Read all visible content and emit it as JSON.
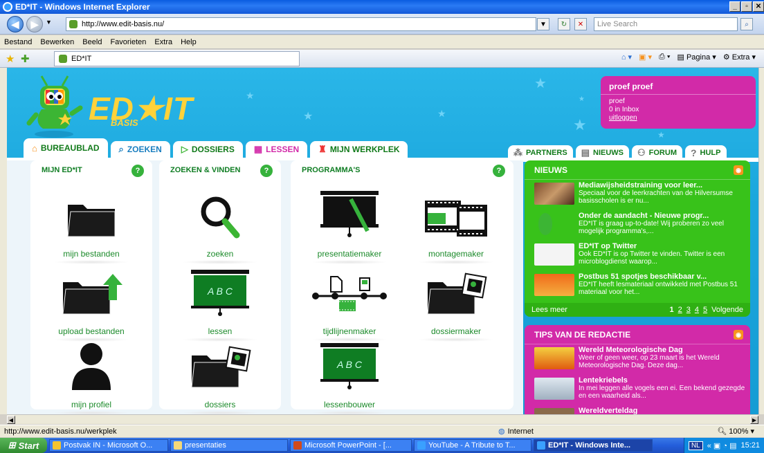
{
  "window": {
    "title": "ED*IT - Windows Internet Explorer"
  },
  "address": {
    "url": "http://www.edit-basis.nu/",
    "search_placeholder": "Live Search"
  },
  "menu": [
    "Bestand",
    "Bewerken",
    "Beeld",
    "Favorieten",
    "Extra",
    "Help"
  ],
  "tab": {
    "title": "ED*IT"
  },
  "commandbar": {
    "page": "Pagina",
    "extra": "Extra"
  },
  "site": {
    "logo_text": "ED★IT",
    "logo_sub": "BASIS",
    "user": {
      "name": "proef proef",
      "line1": "proef",
      "inbox": "0 in Inbox",
      "logout": "uitloggen"
    },
    "tabs_left": [
      {
        "label": "BUREAUBLAD",
        "icon": "home-icon"
      },
      {
        "label": "ZOEKEN",
        "icon": "search-icon"
      },
      {
        "label": "DOSSIERS",
        "icon": "dossier-icon"
      },
      {
        "label": "LESSEN",
        "icon": "lessons-icon"
      },
      {
        "label": "MIJN WERKPLEK",
        "icon": "workplace-icon"
      }
    ],
    "tabs_right": [
      {
        "label": "PARTNERS",
        "icon": "partners-icon"
      },
      {
        "label": "NIEUWS",
        "icon": "news-icon"
      },
      {
        "label": "FORUM",
        "icon": "forum-icon"
      },
      {
        "label": "HULP",
        "icon": "help-icon"
      }
    ],
    "sections": {
      "mijn": {
        "title": "MIJN ED*IT",
        "help": "?",
        "items": [
          "mijn bestanden",
          "upload bestanden",
          "mijn profiel"
        ]
      },
      "zoeken": {
        "title": "ZOEKEN & VINDEN",
        "help": "?",
        "items": [
          "zoeken",
          "lessen",
          "dossiers"
        ]
      },
      "programmas": {
        "title": "PROGRAMMA'S",
        "help": "?",
        "items": [
          "presentatiemaker",
          "montagemaker",
          "tijdlijnenmaker",
          "dossiermaker",
          "lessenbouwer"
        ]
      }
    },
    "board_text": "A B C",
    "nieuws": {
      "title": "NIEUWS",
      "items": [
        {
          "title": "Mediawijsheidstraining voor leer...",
          "text": "Speciaal voor de leerkrachten van de Hilversumse basisscholen is er nu..."
        },
        {
          "title": "Onder de aandacht - Nieuwe progr...",
          "text": "ED*IT is graag up-to-date! Wij proberen zo veel mogelijk programma's,..."
        },
        {
          "title": "ED*IT op Twitter",
          "text": "Ook ED*IT is op Twitter te vinden. Twitter is een microblogdienst waarop..."
        },
        {
          "title": "Postbus 51 spotjes beschikbaar v...",
          "text": "ED*IT heeft lesmateriaal ontwikkeld met Postbus 51 materiaal voor het..."
        }
      ],
      "more": "Lees meer",
      "pages": [
        "1",
        "2",
        "3",
        "4",
        "5"
      ],
      "next": "Volgende"
    },
    "tips": {
      "title": "TIPS VAN DE REDACTIE",
      "items": [
        {
          "title": "Wereld Meteorologische Dag",
          "text": "Weer of geen weer, op 23 maart is het Wereld Meteorologische Dag. Deze dag..."
        },
        {
          "title": "Lentekriebels",
          "text": "In mei leggen alle vogels een ei. Een bekend gezegde en een waarheid als..."
        },
        {
          "title": "Wereldverteldag",
          "text": ""
        }
      ]
    }
  },
  "status": {
    "url": "http://www.edit-basis.nu/werkplek",
    "zone": "Internet",
    "zoom": "100%"
  },
  "taskbar": {
    "start": "Start",
    "items": [
      "Postvak IN - Microsoft O...",
      "presentaties",
      "Microsoft PowerPoint - [...",
      "YouTube - A Tribute to T...",
      "ED*IT - Windows Inte..."
    ],
    "lang": "NL",
    "time": "15:21"
  },
  "colors": {
    "green": "#117a1a",
    "sky": "#1aa6dc",
    "magenta": "#d22aa8",
    "newsgreen": "#38c21a",
    "yellow": "#ffd23a"
  }
}
